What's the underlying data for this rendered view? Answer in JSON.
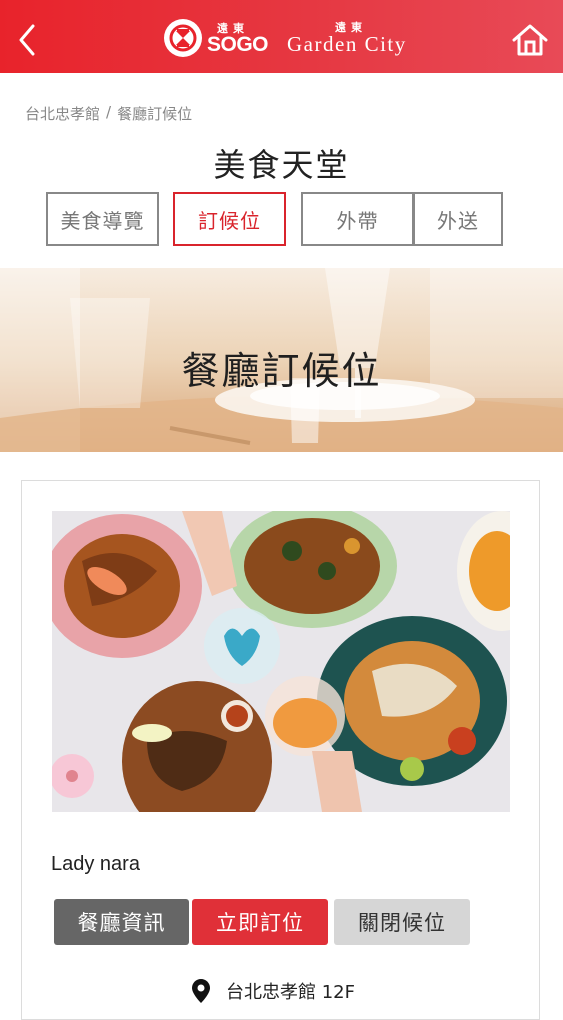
{
  "header": {
    "back_icon": "chevron-left-icon",
    "home_icon": "home-icon",
    "logo_sogo_small": "遠東",
    "logo_sogo": "SOGO",
    "logo_gc_small": "遠東",
    "logo_gc": "Garden City"
  },
  "breadcrumb": {
    "store": "台北忠孝館",
    "separator": "/",
    "current": "餐廳訂候位"
  },
  "page_title": "美食天堂",
  "tabs": [
    {
      "label": "美食導覽",
      "active": false
    },
    {
      "label": "訂候位",
      "active": true
    },
    {
      "label": "外帶",
      "active": false
    },
    {
      "label": "外送",
      "active": false
    }
  ],
  "banner": {
    "title": "餐廳訂候位"
  },
  "restaurant": {
    "name": "Lady nara",
    "buttons": {
      "info": "餐廳資訊",
      "book": "立即訂位",
      "closed": "關閉候位"
    },
    "location_icon": "map-pin-icon",
    "location": "台北忠孝館 12F"
  },
  "colors": {
    "brand_red": "#e8232b",
    "active_tab": "#d9242c",
    "book_button": "#e03038",
    "info_button": "#666666",
    "closed_button": "#d6d6d6"
  }
}
